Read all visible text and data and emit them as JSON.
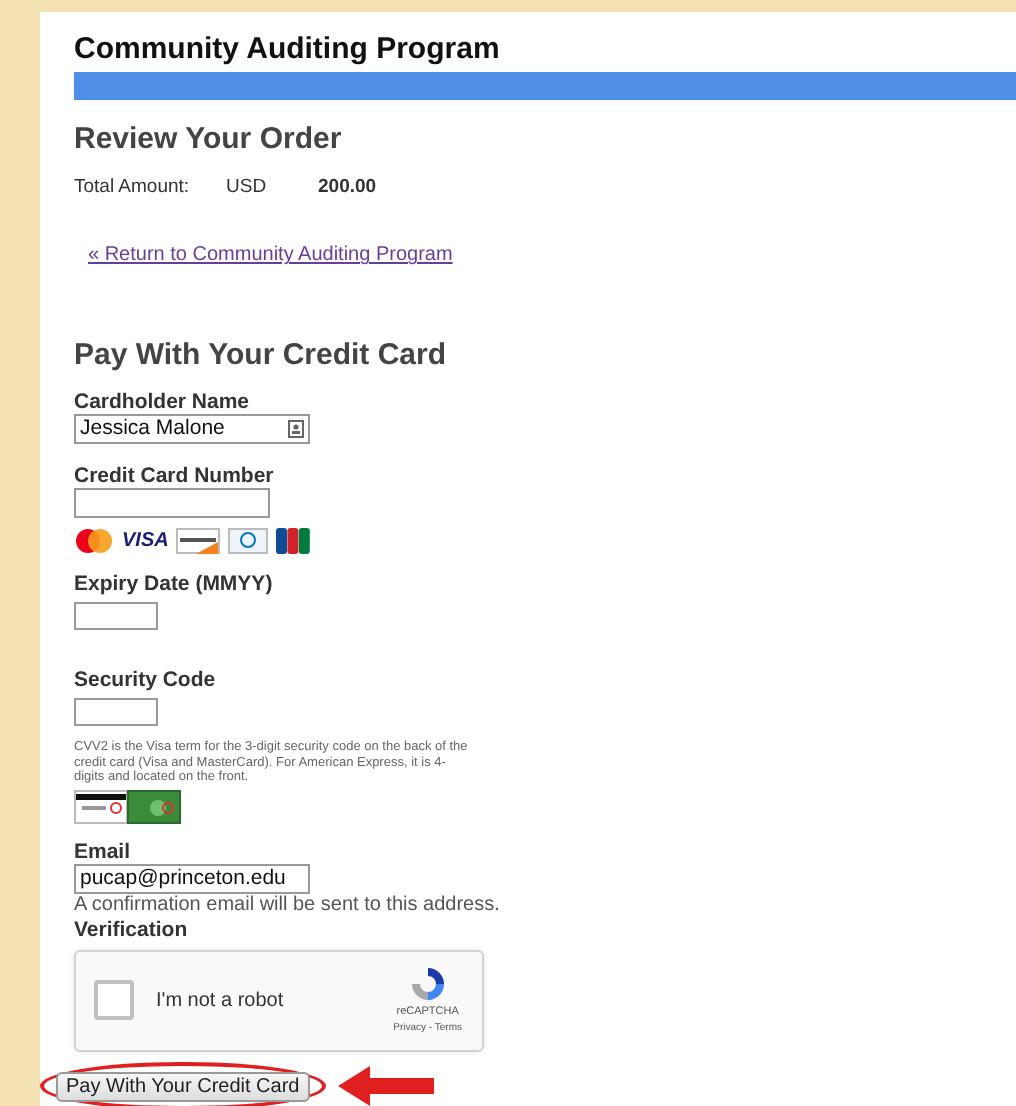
{
  "header": {
    "title": "Community Auditing Program"
  },
  "order": {
    "heading": "Review Your Order",
    "total_label": "Total Amount:",
    "currency": "USD",
    "amount": "200.00",
    "return_link": "« Return to Community Auditing Program"
  },
  "payment": {
    "heading": "Pay With Your Credit Card",
    "cardholder": {
      "label": "Cardholder Name",
      "value": "Jessica Malone"
    },
    "card_number": {
      "label": "Credit Card Number"
    },
    "card_logos": [
      {
        "kind": "mastercard"
      },
      {
        "kind": "visa",
        "label": "VISA"
      },
      {
        "kind": "discover"
      },
      {
        "kind": "diners"
      },
      {
        "kind": "jcb"
      }
    ],
    "expiry": {
      "label": "Expiry Date (MMYY)"
    },
    "security": {
      "label": "Security Code",
      "help": "CVV2 is the Visa term for the 3-digit security code on the back of the credit card (Visa and MasterCard). For American Express, it is 4-digits and located on the front."
    },
    "email": {
      "label": "Email",
      "value": "pucap@princeton.edu",
      "note": "A confirmation email will be sent to this address."
    },
    "verification": {
      "label": "Verification",
      "checkbox_label": "I'm not a robot",
      "checked": false,
      "brand": "reCAPTCHA",
      "links": "Privacy - Terms"
    },
    "submit": "Pay With Your Credit Card"
  }
}
